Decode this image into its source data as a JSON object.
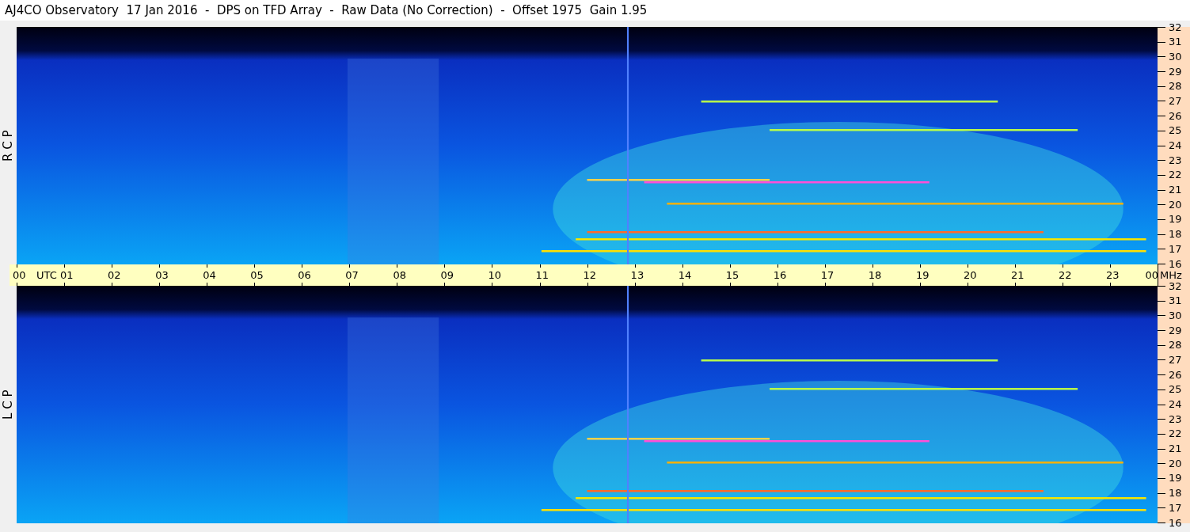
{
  "title": "AJ4CO Observatory  17 Jan 2016  -  DPS on TFD Array  -  Raw Data (No Correction)  -  Offset 1975  Gain 1.95",
  "panels": [
    {
      "label": "R  C  P",
      "frequencies": [
        "32",
        "31",
        "30",
        "29",
        "28",
        "27",
        "26",
        "25",
        "24",
        "23",
        "22",
        "21",
        "20",
        "19",
        "18",
        "17",
        "16"
      ]
    },
    {
      "label": "L  C  P",
      "frequencies": [
        "32",
        "31",
        "30",
        "29",
        "28",
        "27",
        "26",
        "25",
        "24",
        "23",
        "22",
        "21",
        "20",
        "19",
        "18",
        "17",
        "16"
      ]
    }
  ],
  "time_axis": {
    "unit": "UTC",
    "hours": [
      "00",
      "01",
      "02",
      "03",
      "04",
      "05",
      "06",
      "07",
      "08",
      "09",
      "10",
      "11",
      "12",
      "13",
      "14",
      "15",
      "16",
      "17",
      "18",
      "19",
      "20",
      "21",
      "22",
      "23",
      "00"
    ],
    "freq_unit": "MHz"
  }
}
